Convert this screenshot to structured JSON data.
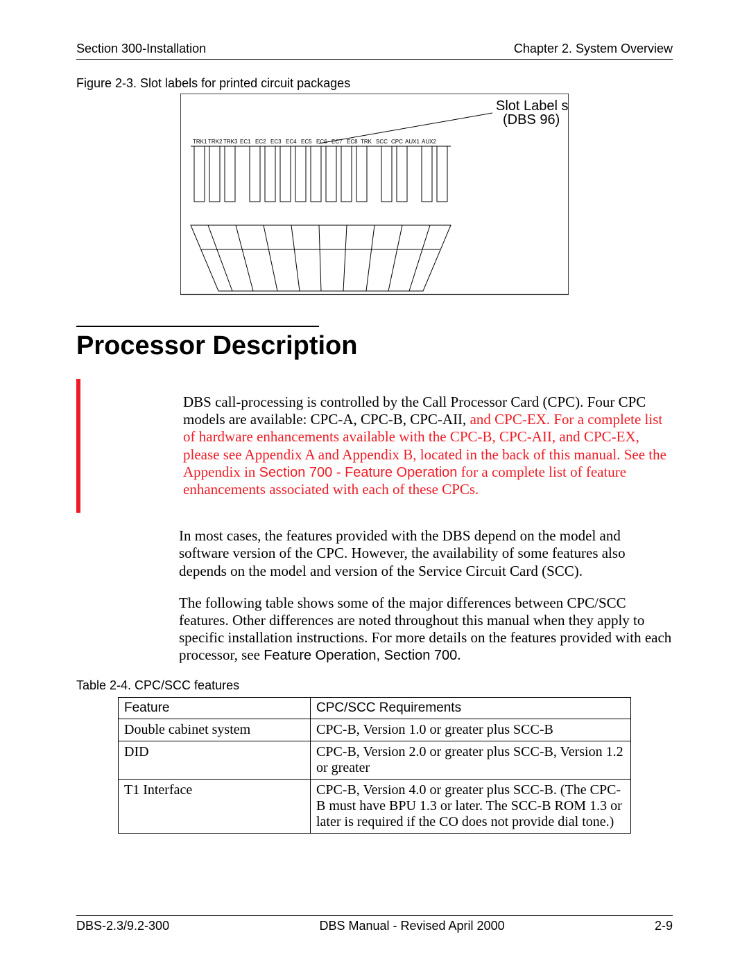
{
  "header": {
    "left": "Section 300-Installation",
    "right": "Chapter 2. System Overview"
  },
  "figure": {
    "caption": "Figure 2-3. Slot labels for printed circuit packages",
    "callout_line1": "Slot Label s",
    "callout_line2": "(DBS 96)",
    "slots": [
      "TRK1",
      "TRK2",
      "TRK3",
      "EC1",
      "EC2",
      "EC3",
      "EC4",
      "EC5",
      "EC6",
      "EC7",
      "EC8",
      "TRK",
      "SCC",
      "CPC",
      "AUX1",
      "AUX2"
    ]
  },
  "section": {
    "title": "Processor Description"
  },
  "para1": {
    "t1": "DBS call-processing is controlled by the Call Processor Card (CPC). Four CPC models are available: CPC-A, CPC-B, CPC-AII,",
    "t2": " and CPC-EX. For a complete list of hardware enhancements available with the CPC-B, CPC-AII, and CPC-EX, please see Appendix A and Appendix B, located in the back of this manual. See the Appendix in ",
    "t3": "Section 700 - Feature Operation",
    "t4": " for a complete list of feature enhancements associated with each of these CPCs."
  },
  "para2": "In most cases, the features provided with the DBS depend on the model and software version of the CPC.  However, the availability of some features also depends on the model and version of the Service Circuit Card (SCC).",
  "para3": {
    "t1": "The following table shows some of the major differences between CPC/SCC features. Other differences are noted throughout this manual when they apply to specific installation instructions. For more details on the features provided with each processor, see ",
    "t2": "Feature Operation, Section 700",
    "t3": "."
  },
  "table": {
    "caption": "Table 2-4.   CPC/SCC features",
    "head": {
      "c1": "Feature",
      "c2": "CPC/SCC Requirements"
    },
    "rows": [
      {
        "c1": "Double cabinet system",
        "c2": "CPC-B, Version 1.0 or greater plus SCC-B"
      },
      {
        "c1": "DID",
        "c2": "CPC-B, Version 2.0 or greater plus  SCC-B, Version 1.2 or greater"
      },
      {
        "c1": "T1 Interface",
        "c2": "CPC-B, Version 4.0 or greater plus SCC-B. (The CPC-B must have BPU 1.3 or later. The SCC-B ROM 1.3 or later is required if the CO does not provide dial tone.)"
      }
    ]
  },
  "footer": {
    "left": "DBS-2.3/9.2-300",
    "center": "DBS Manual - Revised April 2000",
    "right": "2-9"
  }
}
